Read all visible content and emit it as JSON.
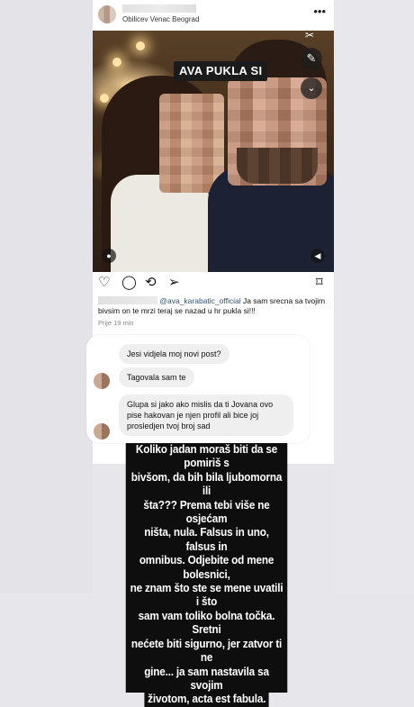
{
  "post": {
    "location": "Obilicev Venac Beograd",
    "more_icon": "more-horizontal-icon",
    "sticker_text": "AVA PUKLA SI",
    "caption_mention": "@ava_karabatic_official",
    "caption_text": " Ja sam srecna sa tvojim bivsim on te mrzi teraj se nazad u hr pukla si!!!",
    "time": "Prije 19 min",
    "actions": [
      "heart-icon",
      "comment-icon",
      "repost-icon",
      "share-icon",
      "bookmark-icon"
    ]
  },
  "dm": {
    "messages": [
      {
        "text": "Jesi vidjela moj novi post?"
      },
      {
        "text": "Tagovala sam te"
      },
      {
        "text": "Glupa si jako ako mislis da ti Jovana ovo pise hakovan je njen profil ali bice joj prosledjen tvoj broj sad"
      }
    ]
  },
  "story": {
    "lines": [
      "Koliko jadan moraš biti da se pomiriš s",
      "bivšom, da bih bila ljubomorna ili",
      "šta??? Prema tebi više ne osjećam",
      "ništa, nula. Falsus in uno, falsus in",
      "omnibus. Odjebite od mene bolesnici,",
      "ne znam što ste se mene uvatili i što",
      "sam vam toliko bolna točka. Sretni",
      "nećete biti sigurno, jer zatvor ti ne",
      "gine... ja sam nastavila sa svojim",
      "životom, acta est fabula."
    ]
  },
  "colors": {
    "background": "#e7e6ea",
    "story_box": "#0e0e0e",
    "bubble": "#efefef",
    "mention": "#31507a"
  }
}
